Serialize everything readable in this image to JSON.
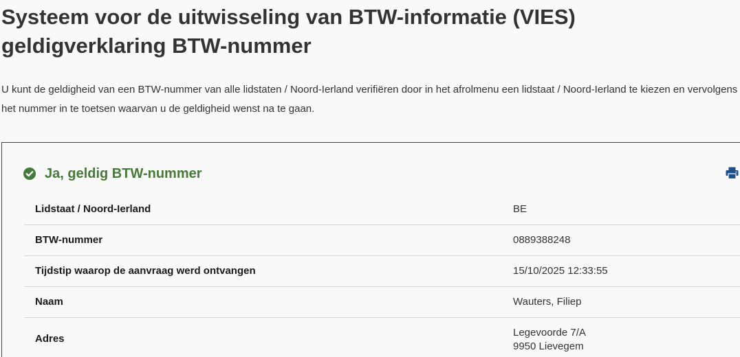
{
  "page": {
    "title": "Systeem voor de uitwisseling van BTW-informatie (VIES) geldigverklaring BTW-nummer",
    "intro": "U kunt de geldigheid van een BTW-nummer van alle lidstaten / Noord-Ierland verifiëren door in het afrolmenu een lidstaat / Noord-Ierland te kiezen en vervolgens het nummer in te toetsen waarvan u de geldigheid wenst na te gaan."
  },
  "result": {
    "status_text": "Ja, geldig BTW-nummer",
    "status_icon": "check-circle-icon",
    "print_icon": "print-icon",
    "colors": {
      "valid": "#467a39",
      "print": "#1f4e8c"
    },
    "rows": [
      {
        "label": "Lidstaat / Noord-Ierland",
        "value": "BE"
      },
      {
        "label": "BTW-nummer",
        "value": "0889388248"
      },
      {
        "label": "Tijdstip waarop de aanvraag werd ontvangen",
        "value": "15/10/2025 12:33:55"
      },
      {
        "label": "Naam",
        "value": "Wauters, Filiep"
      },
      {
        "label": "Adres",
        "value_line1": "Legevoorde 7/A",
        "value_line2": "9950 Lievegem"
      }
    ]
  }
}
